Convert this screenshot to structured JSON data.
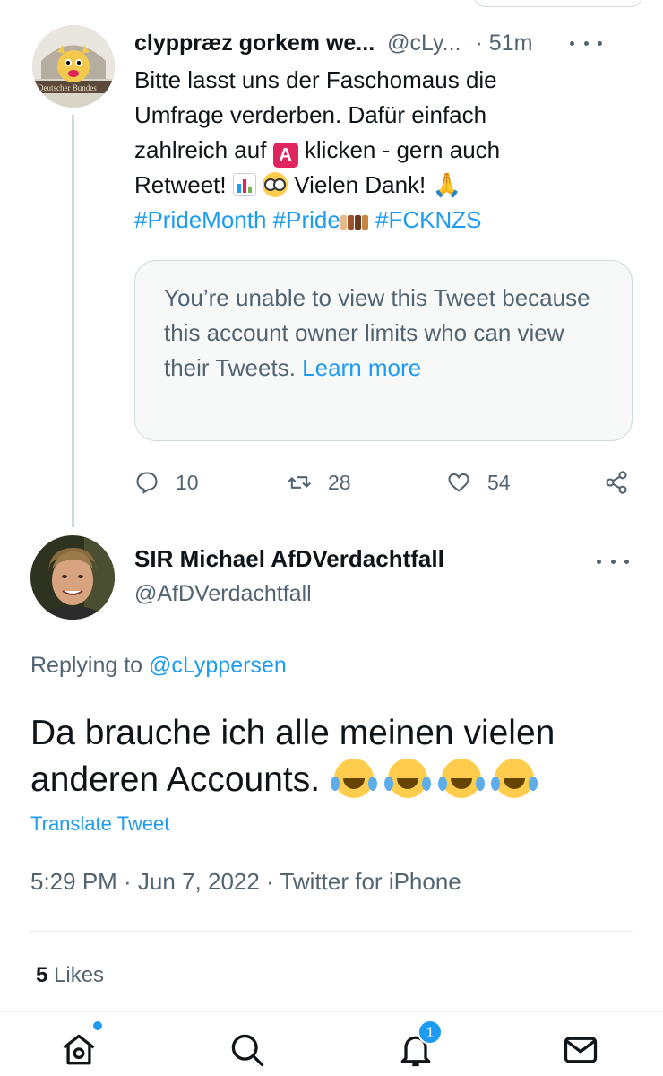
{
  "tweet1": {
    "display_name": "clyppræz gorkem we...",
    "handle": "@cLy...",
    "time": "· 51m",
    "text_line1": "Bitte lasst uns der Faschomaus die",
    "text_line2": "Umfrage verderben. Dafür einfach",
    "text_line3a": "zahlreich auf",
    "emoji_letter": "A",
    "text_line3b": "klicken - gern auch",
    "text_line4a": "Retweet!",
    "text_line4b": "Vielen Dank!",
    "hashtag1": "#PrideMonth",
    "hashtag2": "#Pride",
    "hashtag3": "#FCKNZS",
    "limited_notice": "You’re unable to view this Tweet because this account owner limits who can view their Tweets.",
    "learn_more": "Learn more",
    "replies": "10",
    "retweets": "28",
    "likes": "54",
    "avatar_caption": "Deutscher Bundes"
  },
  "tweet2": {
    "display_name": "SIR Michael AfDVerdachtfall",
    "handle": "@AfDVerdachtfall",
    "replying_prefix": "Replying to",
    "replying_handle": "@cLyppersen",
    "text_line1": "Da brauche ich alle meinen vielen",
    "text_line2": "anderen Accounts.",
    "translate": "Translate Tweet",
    "meta": "5:29 PM · Jun 7, 2022 · Twitter for iPhone",
    "likes_count": "5",
    "likes_label": "Likes"
  },
  "nav": {
    "notification_badge": "1",
    "items": [
      "home-icon",
      "search-icon",
      "notifications-icon",
      "messages-icon"
    ]
  },
  "colors": {
    "accent": "#1d9bf0",
    "text": "#0f1419",
    "secondary": "#536471",
    "border": "#cfd9de"
  }
}
